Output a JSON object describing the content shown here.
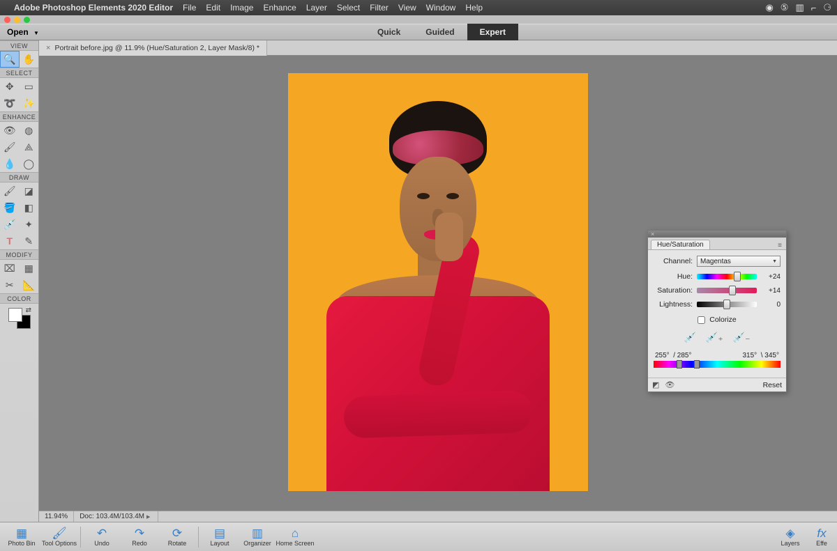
{
  "menubar": {
    "app_name": "Adobe Photoshop Elements 2020 Editor",
    "items": [
      "File",
      "Edit",
      "Image",
      "Enhance",
      "Layer",
      "Select",
      "Filter",
      "View",
      "Window",
      "Help"
    ]
  },
  "modebar": {
    "open": "Open",
    "modes": [
      "Quick",
      "Guided",
      "Expert"
    ],
    "active": "Expert"
  },
  "toolbox": {
    "sections": {
      "view": "VIEW",
      "select": "SELECT",
      "enhance": "ENHANCE",
      "draw": "DRAW",
      "modify": "MODIFY",
      "color": "COLOR"
    }
  },
  "document": {
    "tab_title": "Portrait before.jpg @ 11.9% (Hue/Saturation 2, Layer Mask/8) *",
    "zoom_status": "11.94%",
    "doc_status": "Doc: 103.4M/103.4M"
  },
  "hs_panel": {
    "title": "Hue/Saturation",
    "channel_label": "Channel:",
    "channel_value": "Magentas",
    "hue_label": "Hue:",
    "hue_value": "+24",
    "sat_label": "Saturation:",
    "sat_value": "+14",
    "lig_label": "Lightness:",
    "lig_value": "0",
    "colorize_label": "Colorize",
    "range_l1": "255°",
    "range_l2": "/ 285°",
    "range_r1": "315°",
    "range_r2": "\\ 345°",
    "reset": "Reset"
  },
  "bottombar": {
    "photo_bin": "Photo Bin",
    "tool_options": "Tool Options",
    "undo": "Undo",
    "redo": "Redo",
    "rotate": "Rotate",
    "layout": "Layout",
    "organizer": "Organizer",
    "home": "Home Screen",
    "layers": "Layers",
    "effects": "Effe"
  }
}
